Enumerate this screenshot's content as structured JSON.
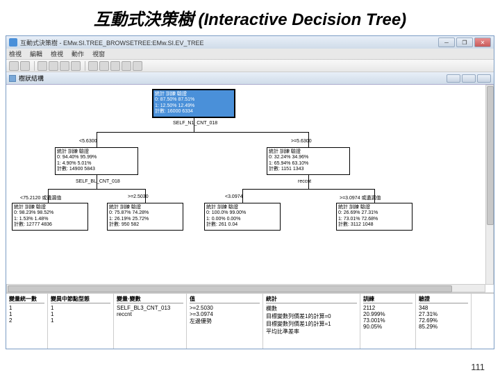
{
  "page_title": "互動式決策樹 (Interactive Decision Tree)",
  "window": {
    "title": "互動式決策樹 - EMw.SI.TREE_BROWSETREE:EMw.SI.EV_TREE",
    "min": "─",
    "max": "❐",
    "close": "✕"
  },
  "menu": [
    "檢視",
    "編輯",
    "檢視",
    "動作",
    "視窗"
  ],
  "inner_title": "樹狀結構",
  "tree": {
    "root": {
      "header": "統計    訓練    驗證",
      "r1": "0:  87.50%  87.51%",
      "r2": "1:  12.50%  12.49%",
      "count": "計數:  16000    6334"
    },
    "split1": "SELF_N1_CNT_018",
    "cond_l": "<5.6300",
    "cond_r": ">=5.6300",
    "nL": {
      "header": "統計    訓練    驗證",
      "r1": "0:  94.40%  95.99%",
      "r2": "1:   4.90%   5.01%",
      "count": "計數:  14900   5843"
    },
    "nR": {
      "header": "統計    訓練    驗證",
      "r1": "0:  32.24%  34.96%",
      "r2": "1:  65.94%  63.10%",
      "count": "計數:   1151   1343"
    },
    "split2L": "SELF_BL_CNT_018",
    "split2R": "reccnt",
    "condLL": "<75.2120 或遺漏值",
    "condLR": ">=2.5030",
    "condRL": "<3.0974",
    "condRR": ">=3.0974 或遺漏值",
    "leafLL": {
      "header": "統計   訓練   驗證",
      "r1": "0: 98.23% 98.52%",
      "r2": "1:  1.53%  1.48%",
      "count": "計數: 12777  4836"
    },
    "leafLR": {
      "header": "統計   訓練   驗證",
      "r1": "0: 75.87% 74.28%",
      "r2": "1: 26.19% 25.72%",
      "count": "計數:   950    582"
    },
    "leafRL": {
      "header": "統計   訓練   驗證",
      "r1": "0: 100.0% 99.00%",
      "r2": "1:  0.00%  0.00%",
      "count": "計數:   261   0.04"
    },
    "leafRR": {
      "header": "統計   訓練   驗證",
      "r1": "0: 26.69% 27.31%",
      "r2": "1: 73.01% 72.68%",
      "count": "計數:  3112   1048"
    }
  },
  "stats": {
    "c1_head": "變量統一數",
    "c1_rows": [
      "1",
      "1",
      "2"
    ],
    "c2_head": "變異中節點型態",
    "c2_rows": [
      "1",
      "1",
      "1"
    ],
    "c3_head": "變量·變數",
    "c3_rows": [
      "SELF_BL3_CNT_013",
      "reccnt",
      ""
    ],
    "c4_head": "值",
    "c4_rows": [
      ">=2.5030",
      ">=3.0974",
      "左邊優勢"
    ],
    "c5_head": "統計",
    "c5_rows": [
      "欄數",
      "目標變數列價差1的計算=0",
      "目標變數列價差1的計算=1",
      "平均比準差率"
    ],
    "c6_head": "訓練",
    "c6_rows": [
      "2112",
      "20.999%",
      "73.001%",
      "90.05%"
    ],
    "c7_head": "驗證",
    "c7_rows": [
      "348",
      "27.31%",
      "72.69%",
      "85.29%"
    ]
  },
  "page_num": "111"
}
